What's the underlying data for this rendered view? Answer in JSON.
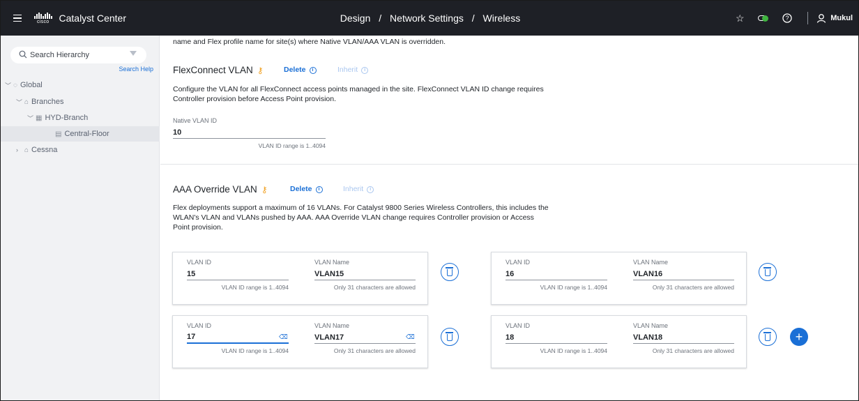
{
  "header": {
    "app_title": "Catalyst Center",
    "cisco_word": "cisco",
    "breadcrumb": [
      "Design",
      "Network Settings",
      "Wireless"
    ],
    "breadcrumb_sep": "/",
    "user_name": "Mukul",
    "icons": [
      "menu-icon",
      "star-icon",
      "health-icon",
      "help-icon",
      "user-icon"
    ]
  },
  "sidebar": {
    "search_placeholder": "Search Hierarchy",
    "search_help": "Search Help",
    "tree": [
      {
        "label": "Global",
        "icon": "location-icon",
        "expanded": true,
        "level": 0
      },
      {
        "label": "Branches",
        "icon": "building-icon",
        "expanded": true,
        "level": 1
      },
      {
        "label": "HYD-Branch",
        "icon": "floor-building-icon",
        "expanded": true,
        "level": 2
      },
      {
        "label": "Central-Floor",
        "icon": "floor-icon",
        "selected": true,
        "level": 3
      },
      {
        "label": "Cessna",
        "icon": "building-icon",
        "expanded": false,
        "level": 1
      }
    ]
  },
  "main": {
    "intro_text": "name and Flex profile name for site(s) where Native VLAN/AAA VLAN is overridden.",
    "flexconnect": {
      "title": "FlexConnect VLAN",
      "delete_label": "Delete",
      "inherit_label": "Inherit",
      "description_line1": "Configure the VLAN for all FlexConnect access points managed in the site. FlexConnect VLAN ID change requires",
      "description_line2": "Controller provision before Access Point provision.",
      "native_vlan_label": "Native VLAN ID",
      "native_vlan_value": "10",
      "native_vlan_helper": "VLAN ID range is 1..4094"
    },
    "aaa": {
      "title": "AAA Override VLAN",
      "delete_label": "Delete",
      "inherit_label": "Inherit",
      "description_line1": "Flex deployments support a maximum of 16 VLANs. For Catalyst 9800 Series Wireless Controllers, this includes the",
      "description_line2": "WLAN's VLAN and VLANs pushed by AAA. AAA Override VLAN change requires Controller provision or Access",
      "description_line3": "Point provision.",
      "vlan_id_label": "VLAN ID",
      "vlan_name_label": "VLAN Name",
      "vlan_id_helper": "VLAN ID range is 1..4094",
      "vlan_name_helper": "Only 31 characters are allowed",
      "entries": [
        {
          "vlan_id": "15",
          "vlan_name": "VLAN15"
        },
        {
          "vlan_id": "16",
          "vlan_name": "VLAN16"
        },
        {
          "vlan_id": "17",
          "vlan_name": "VLAN17"
        },
        {
          "vlan_id": "18",
          "vlan_name": "VLAN18"
        }
      ]
    }
  },
  "colors": {
    "topbar": "#1e2026",
    "accent": "#1a6fd6",
    "key_icon": "#f0a020",
    "health_green": "#3fb43f"
  }
}
